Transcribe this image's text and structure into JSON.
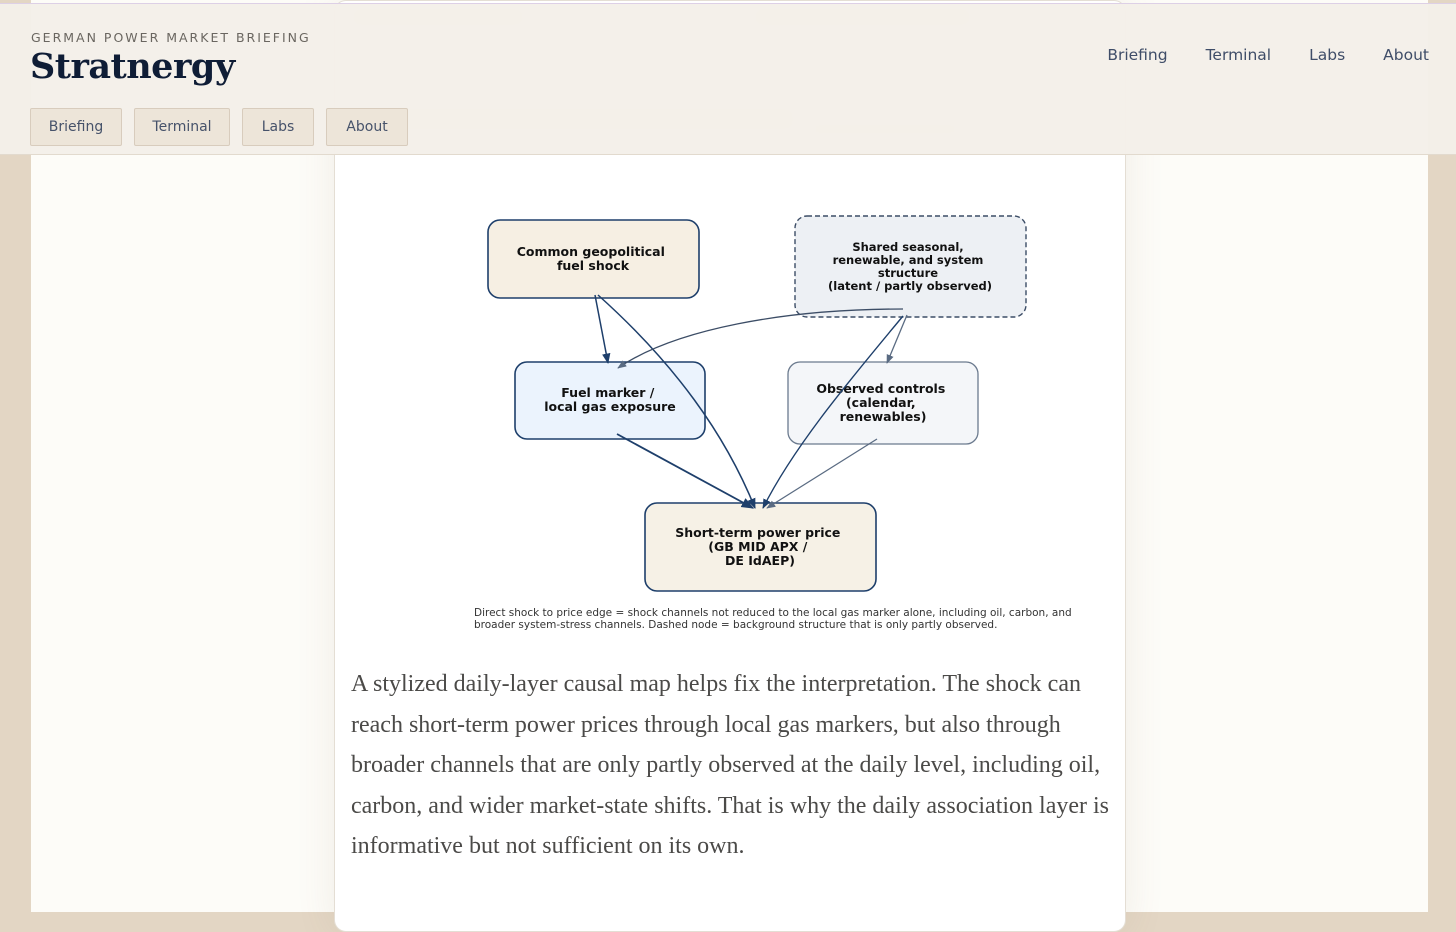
{
  "header": {
    "kicker": "GERMAN POWER MARKET BRIEFING",
    "brand": "Stratnergy",
    "nav_items": [
      "Briefing",
      "Terminal",
      "Labs",
      "About"
    ]
  },
  "diagram": {
    "nodes": {
      "shock": [
        "Common geopolitical",
        "fuel shock"
      ],
      "seasonal": [
        "Shared seasonal,",
        "renewable, and system",
        "structure",
        "(latent / partly observed)"
      ],
      "fuel": [
        "Fuel marker /",
        "local gas exposure"
      ],
      "controls": [
        "Observed controls",
        "(calendar,",
        "renewables)"
      ],
      "price": [
        "Short-term power price",
        "(GB MID APX /",
        "DE IdAEP)"
      ]
    },
    "caption": "Direct shock to price edge = shock channels not reduced to the local gas marker alone, including oil, carbon, and broader system-stress channels. Dashed node = background structure that is only partly observed."
  },
  "article": {
    "paragraph": "A stylized daily-layer causal map helps fix the interpretation. The shock can reach short-term power prices through local gas markers, but also through broader channels that are only partly observed at the daily level, including oil, carbon, and wider market-state shifts. That is why the daily association layer is informative but not sufficient on its own."
  },
  "colors": {
    "brand": "#0f1d36",
    "node_border": "#1e3f6b",
    "edge_dark": "#1e3f6b",
    "edge_light": "#5a6b82"
  }
}
